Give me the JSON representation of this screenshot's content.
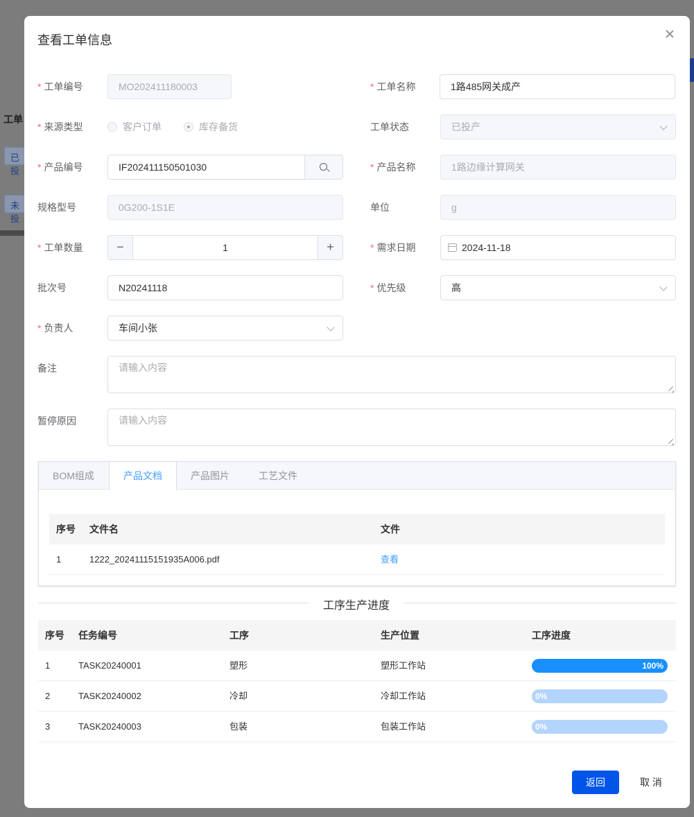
{
  "background": {
    "header_text": "工单",
    "tag1": "已投",
    "tag2": "未投"
  },
  "dialog": {
    "title": "查看工单信息"
  },
  "form": {
    "order_no": {
      "label": "工单编号",
      "value": "MO202411180003"
    },
    "order_name": {
      "label": "工单名称",
      "value": "1路485网关成产"
    },
    "source_type": {
      "label": "来源类型",
      "options": [
        "客户订单",
        "库存备货"
      ],
      "selected": "库存备货"
    },
    "order_status": {
      "label": "工单状态",
      "value": "已投产"
    },
    "product_code": {
      "label": "产品编号",
      "value": "IF202411150501030"
    },
    "product_name": {
      "label": "产品名称",
      "value": "1路边缘计算网关"
    },
    "spec": {
      "label": "规格型号",
      "value": "0G200-1S1E"
    },
    "unit": {
      "label": "单位",
      "value": "g"
    },
    "quantity": {
      "label": "工单数量",
      "value": "1",
      "minus": "−",
      "plus": "+"
    },
    "demand_date": {
      "label": "需求日期",
      "value": "2024-11-18"
    },
    "batch_no": {
      "label": "批次号",
      "value": "N20241118"
    },
    "priority": {
      "label": "优先级",
      "value": "高"
    },
    "owner": {
      "label": "负责人",
      "value": "车间小张"
    },
    "remark": {
      "label": "备注",
      "placeholder": "请输入内容"
    },
    "pause_reason": {
      "label": "暂停原因",
      "placeholder": "请输入内容"
    }
  },
  "tabs": {
    "items": [
      "BOM组成",
      "产品文档",
      "产品图片",
      "工艺文件"
    ],
    "active": "产品文档"
  },
  "doc_table": {
    "headers": [
      "序号",
      "文件名",
      "文件"
    ],
    "rows": [
      {
        "index": "1",
        "filename": "1222_20241115151935A006.pdf",
        "action": "查看"
      }
    ]
  },
  "progress_section": {
    "title": "工序生产进度",
    "headers": [
      "序号",
      "任务编号",
      "工序",
      "生产位置",
      "工序进度"
    ],
    "rows": [
      {
        "index": "1",
        "task": "TASK20240001",
        "process": "塑形",
        "location": "塑形工作站",
        "progress": 100,
        "progress_label": "100%"
      },
      {
        "index": "2",
        "task": "TASK20240002",
        "process": "冷却",
        "location": "冷却工作站",
        "progress": 0,
        "progress_label": "0%"
      },
      {
        "index": "3",
        "task": "TASK20240003",
        "process": "包装",
        "location": "包装工作站",
        "progress": 0,
        "progress_label": "0%"
      }
    ]
  },
  "footer": {
    "back_label": "返回",
    "cancel_label": "取 消"
  },
  "colors": {
    "primary": "#0055e8",
    "link": "#409eff",
    "required": "#f56c6c",
    "progress_fill": "#1890ff",
    "progress_track": "#b3d4fc"
  }
}
